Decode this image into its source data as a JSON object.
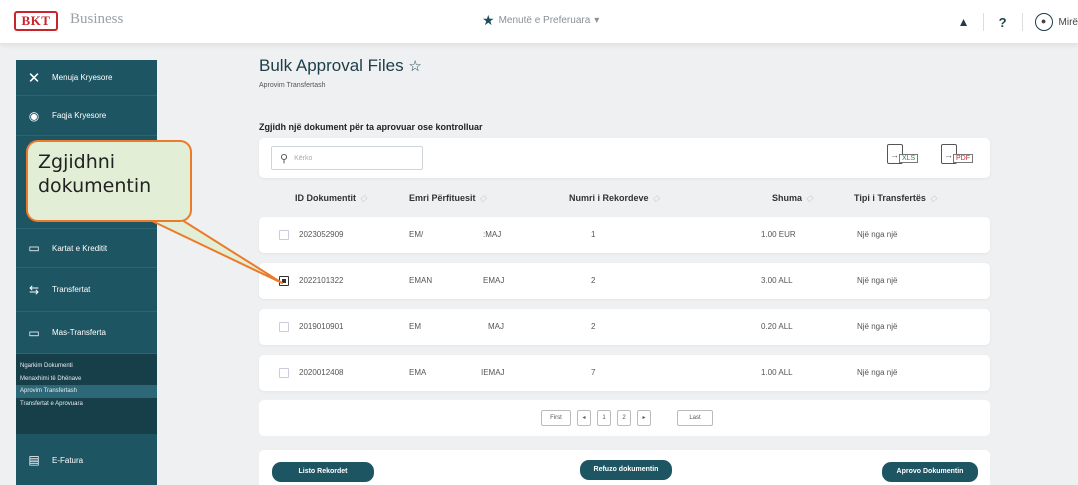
{
  "header": {
    "logo_text": "BKT",
    "brand_tag": "Business",
    "favorites_label": "Menutë e Preferuara",
    "favorites_caret": "▾",
    "help_label": "?",
    "user_label": "Mirë"
  },
  "sidebar": {
    "items": [
      {
        "label": "Menuja Kryesore",
        "icon": "close-icon"
      },
      {
        "label": "Faqja Kryesore",
        "icon": "home-icon"
      },
      {
        "label": "Kartat e Kreditit",
        "icon": "credit-card-icon"
      },
      {
        "label": "Transfertat",
        "icon": "transfer-icon"
      },
      {
        "label": "Mas-Transferta",
        "icon": "bulk-transfer-icon"
      },
      {
        "label": "E-Fatura",
        "icon": "invoice-icon"
      }
    ],
    "subitems": [
      {
        "label": "Ngarkim Dokumenti"
      },
      {
        "label": "Menaxhimi të Dhënave"
      },
      {
        "label": "Aprovim Transfertash"
      },
      {
        "label": "Transfertat e Aprovuara"
      }
    ]
  },
  "page": {
    "title": "Bulk Approval Files",
    "subtitle": "Aprovim Transfertash",
    "section_heading": "Zgjidh një dokument për ta aprovuar ose kontrolluar"
  },
  "search": {
    "placeholder": "Kërko"
  },
  "export": {
    "xls": "XLS",
    "pdf": "PDF"
  },
  "table": {
    "columns": [
      "ID Dokumentit",
      "Emri Përfituesit",
      "Numri i Rekordeve",
      "Shuma",
      "Tipi i Transfertës"
    ],
    "rows": [
      {
        "id": "2023052909",
        "name_a": "EM/",
        "name_b": ":MAJ",
        "records": "1",
        "amount": "1.00 EUR",
        "type": "Një nga një",
        "checked": false
      },
      {
        "id": "2022101322",
        "name_a": "EMAN",
        "name_b": "EMAJ",
        "records": "2",
        "amount": "3.00 ALL",
        "type": "Një nga një",
        "checked": true
      },
      {
        "id": "2019010901",
        "name_a": "EM",
        "name_b": "MAJ",
        "records": "2",
        "amount": "0.20 ALL",
        "type": "Një nga një",
        "checked": false
      },
      {
        "id": "2020012408",
        "name_a": "EMA",
        "name_b": "IEMAJ",
        "records": "7",
        "amount": "1.00 ALL",
        "type": "Një nga një",
        "checked": false
      }
    ]
  },
  "pagination": {
    "first": "First",
    "prev": "◂",
    "pages": [
      "1",
      "2"
    ],
    "next": "▸",
    "last": "Last"
  },
  "actions": {
    "list_records": "Listo Rekordet",
    "reject": "Refuzo dokumentin",
    "approve": "Aprovo Dokumentin"
  },
  "callout": {
    "line1": "Zgjidhni",
    "line2": "dokumentin"
  },
  "colors": {
    "primary": "#1e5563",
    "accent": "#ec7a2b",
    "callout_bg": "#e2efd6",
    "brand_red": "#c8242b"
  }
}
